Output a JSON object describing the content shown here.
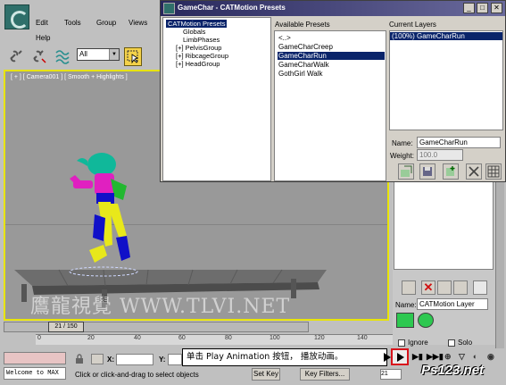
{
  "menu": {
    "edit": "Edit",
    "tools": "Tools",
    "group": "Group",
    "views": "Views",
    "help": "Help"
  },
  "toolbar": {
    "selection_filter": "All"
  },
  "viewport": {
    "label": "[ + ] [ Camera001 ] [ Smooth + Highlights ]",
    "watermark": "鷹龍視覺 WWW.TLVI.NET"
  },
  "timeline": {
    "frame_display": "21 / 150",
    "ticks": [
      "0",
      "20",
      "40",
      "60",
      "80",
      "100",
      "120",
      "140"
    ]
  },
  "status": {
    "welcome": "Welcome to MAX",
    "prompt": "Click or click-and-drag to select objects",
    "x_label": "X:",
    "y_label": "Y:",
    "set_key": "Set Key",
    "key_filters": "Key Filters...",
    "frame": "21"
  },
  "callout": {
    "text": "单击 Play Animation 按钮， 播放动画。"
  },
  "brand": {
    "logo_text": "Ps123.net"
  },
  "command_panel": {
    "name_label": "Name:",
    "layer_name": "CATMotion Layer",
    "ignore_label": "Ignore",
    "solo_label": "Solo"
  },
  "cat_window": {
    "title": "GameChar - CATMotion Presets",
    "tree": [
      {
        "label": "CATMotion Presets",
        "selected": true
      },
      {
        "label": "Globals",
        "selected": false
      },
      {
        "label": "LimbPhases",
        "selected": false
      },
      {
        "label": "[+] PelvisGroup",
        "selected": false
      },
      {
        "label": "[+] RibcageGroup",
        "selected": false
      },
      {
        "label": "[+] HeadGroup",
        "selected": false
      }
    ],
    "available_header": "Available Presets",
    "available_presets": [
      {
        "label": "<..>",
        "selected": false
      },
      {
        "label": "GameCharCreep",
        "selected": false
      },
      {
        "label": "GameCharRun",
        "selected": true
      },
      {
        "label": "GameCharWalk",
        "selected": false
      },
      {
        "label": "GothGirl Walk",
        "selected": false
      }
    ],
    "current_header": "Current Layers",
    "current_layer": "(100%) GameCharRun",
    "name_label": "Name:",
    "name_value": "GameCharRun",
    "weight_label": "Weight:",
    "weight_value": "100.0"
  },
  "colors": {
    "viewport_border": "#e8e400",
    "window_title": "#28285c",
    "selection": "#0a246a",
    "play_highlight": "#d8141c",
    "layer_color": "#2dc850"
  }
}
